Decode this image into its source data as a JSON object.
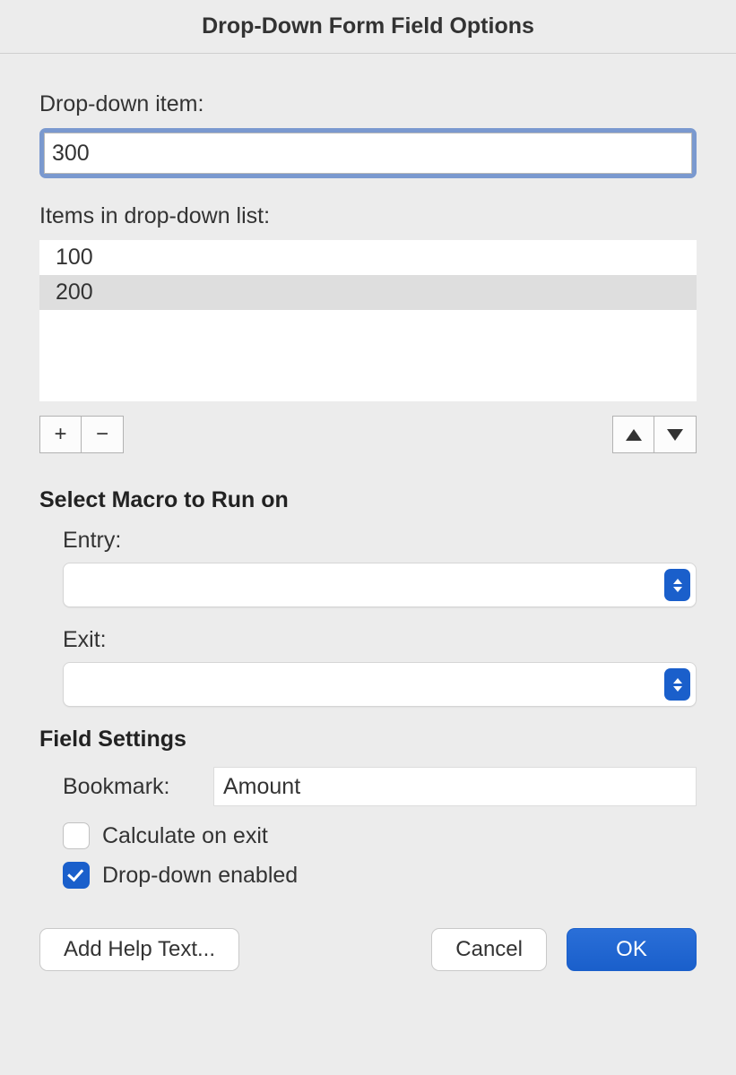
{
  "dialog": {
    "title": "Drop-Down Form Field Options"
  },
  "dropdown_item": {
    "label": "Drop-down item:",
    "value": "300"
  },
  "list": {
    "label": "Items in drop-down list:",
    "items": [
      {
        "value": "100",
        "selected": false
      },
      {
        "value": "200",
        "selected": true
      }
    ]
  },
  "macro": {
    "heading": "Select Macro to Run on",
    "entry_label": "Entry:",
    "entry_value": "",
    "exit_label": "Exit:",
    "exit_value": ""
  },
  "field_settings": {
    "heading": "Field Settings",
    "bookmark_label": "Bookmark:",
    "bookmark_value": "Amount",
    "calculate_label": "Calculate on exit",
    "calculate_checked": false,
    "enabled_label": "Drop-down enabled",
    "enabled_checked": true
  },
  "buttons": {
    "help": "Add Help Text...",
    "cancel": "Cancel",
    "ok": "OK"
  }
}
